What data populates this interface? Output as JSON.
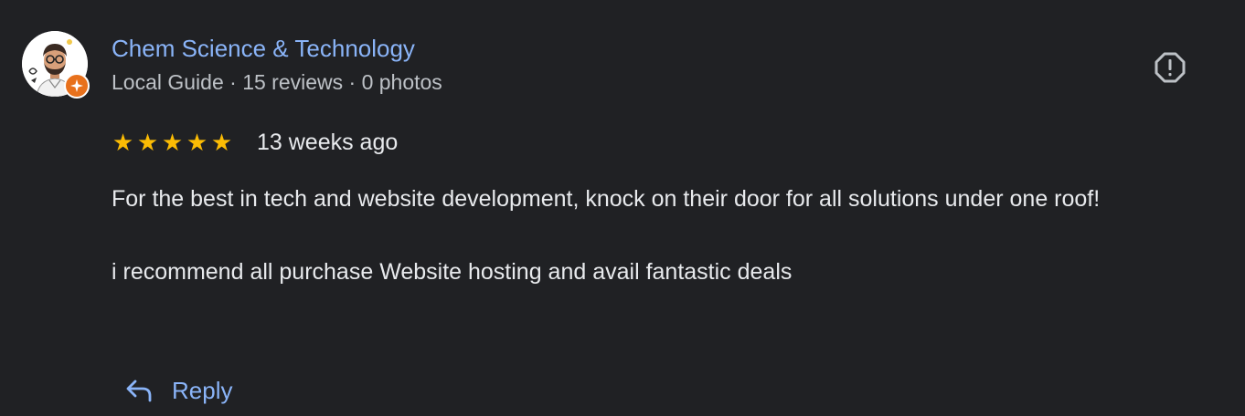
{
  "review": {
    "author": {
      "name": "Chem Science & Technology",
      "meta": "Local Guide · 15 reviews · 0 photos",
      "avatar_icon": "person-avatar",
      "badge_icon": "local-guide-star-icon"
    },
    "rating": {
      "stars": 5,
      "max": 5,
      "star_char": "★",
      "star_color": "#fbbc04"
    },
    "date": "13 weeks ago",
    "paragraphs": [
      "For the best in tech and website development, knock on their door for all solutions under one roof!",
      "i recommend all purchase Website hosting and avail fantastic deals"
    ],
    "flag_icon": "report-flag-icon",
    "reply": {
      "label": "Reply",
      "icon": "reply-arrow-icon"
    }
  },
  "colors": {
    "background": "#202124",
    "link": "#8ab4f8",
    "text": "#e8eaed",
    "secondary_text": "#bdc1c6",
    "badge": "#e8711c"
  }
}
